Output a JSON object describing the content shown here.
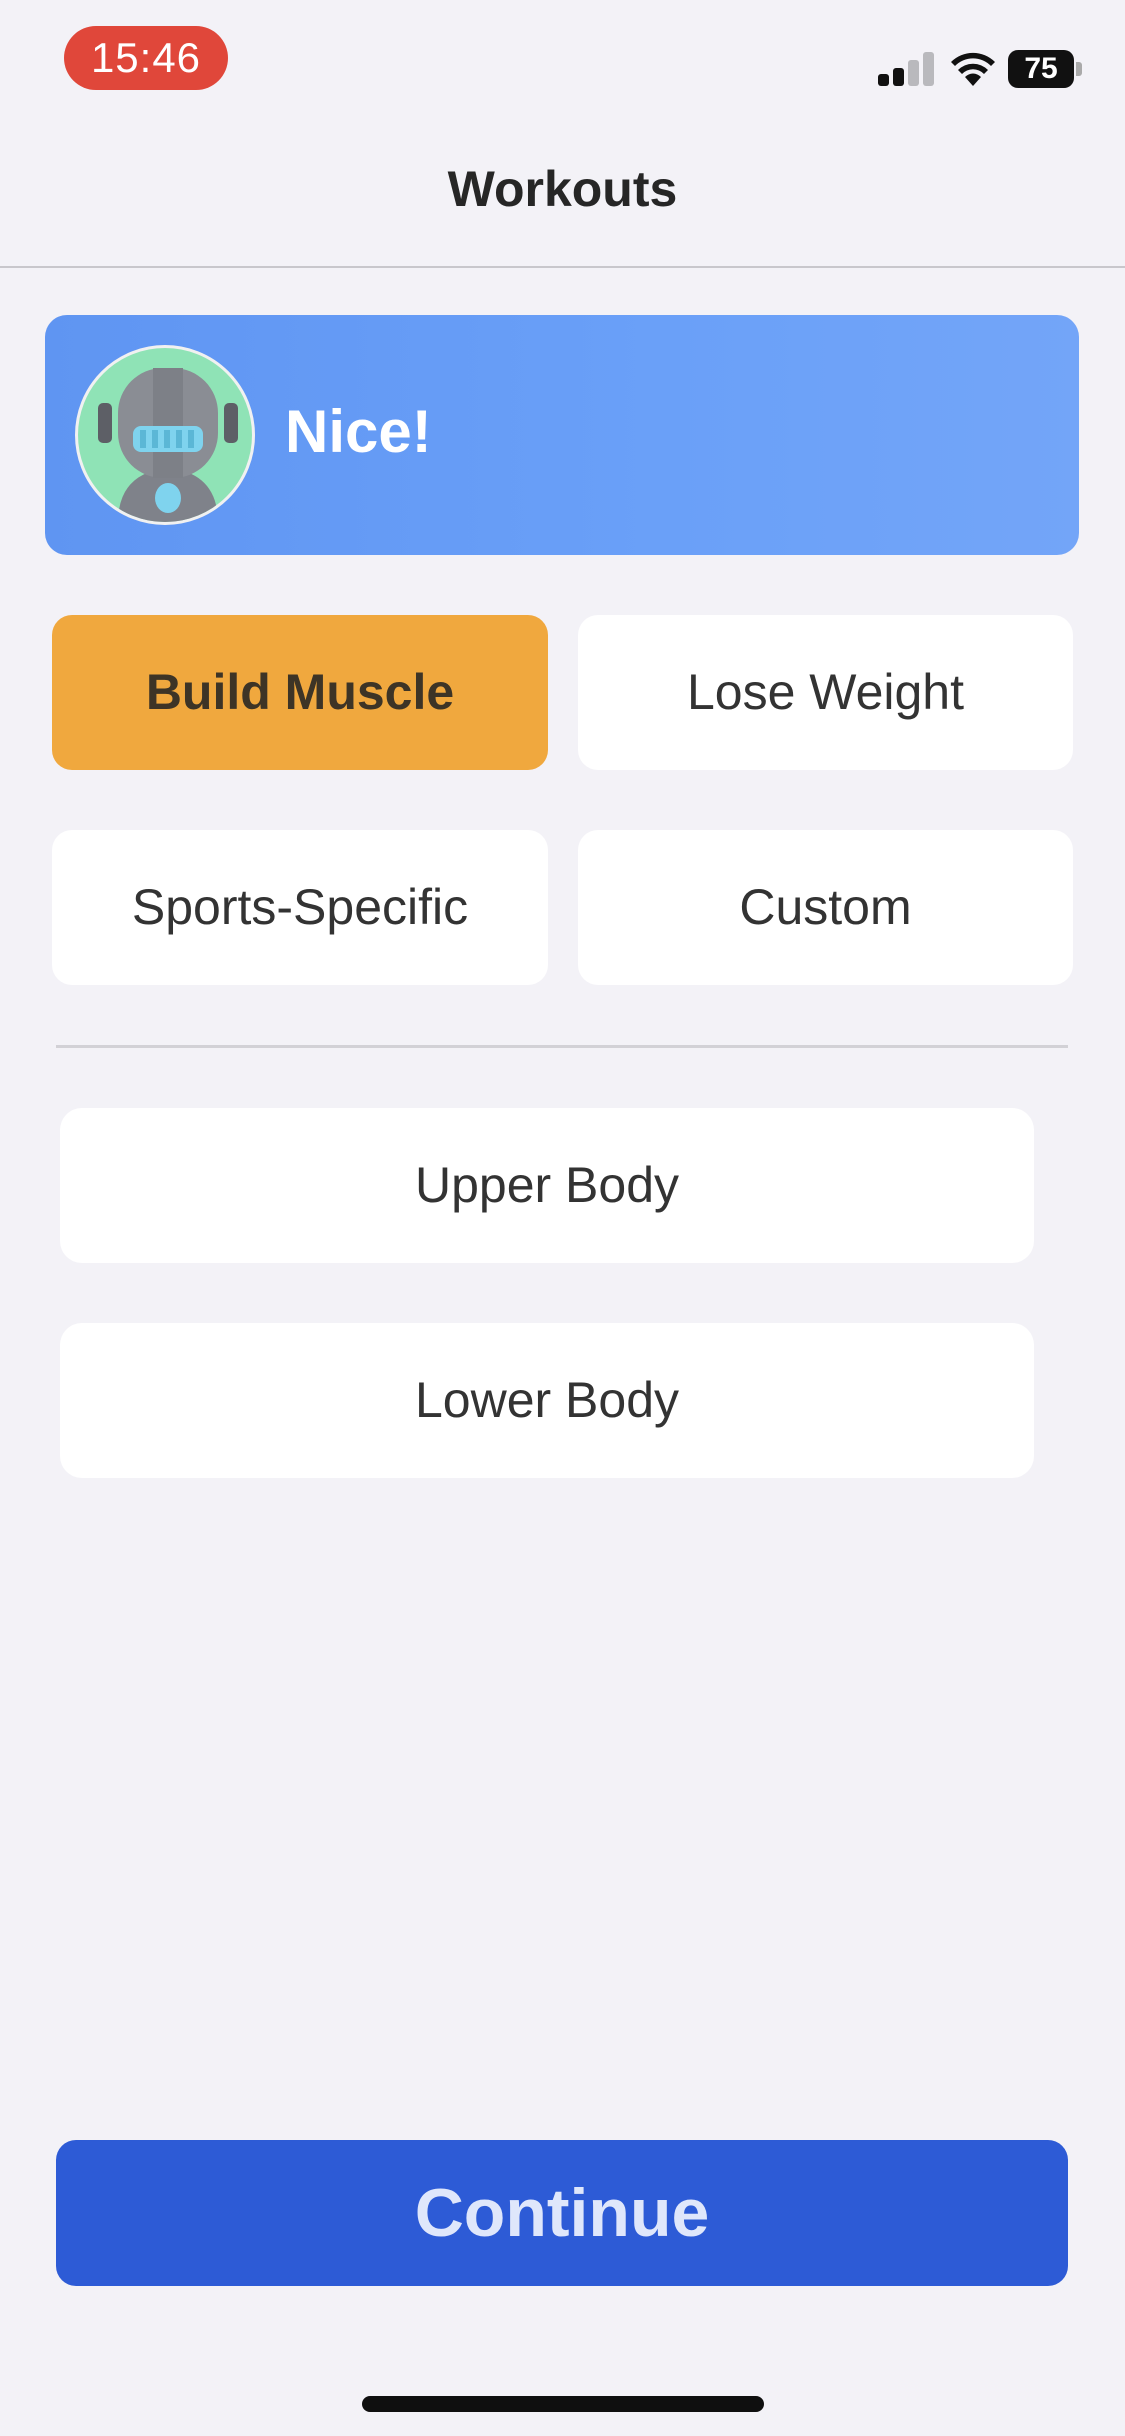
{
  "status_bar": {
    "time": "15:46",
    "battery": "75"
  },
  "nav": {
    "title": "Workouts"
  },
  "banner": {
    "message": "Nice!"
  },
  "goals": [
    {
      "label": "Build Muscle",
      "selected": true
    },
    {
      "label": "Lose Weight",
      "selected": false
    },
    {
      "label": "Sports-Specific",
      "selected": false
    },
    {
      "label": "Custom",
      "selected": false
    }
  ],
  "focus_options": [
    {
      "label": "Upper Body"
    },
    {
      "label": "Lower Body"
    }
  ],
  "continue_label": "Continue",
  "colors": {
    "accent": "#2d5bd6",
    "selected_chip": "#f0a83e",
    "banner": "#6aa0f8",
    "time_pill": "#e0473a",
    "background": "#f3f2f7"
  }
}
